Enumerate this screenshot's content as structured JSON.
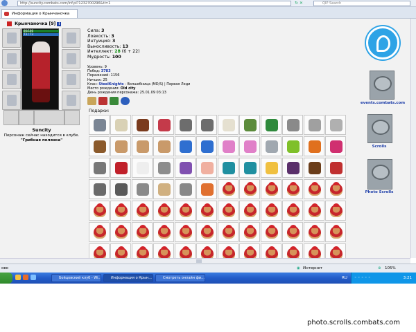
{
  "browser": {
    "url": "http://suncity.combats.com/inf.pl?1232?00296&tl=1",
    "search_placeholder": "QIP Search",
    "tab_title": "Информация о Крынчаночка"
  },
  "character": {
    "name": "Крынчаночка",
    "level_badge": "[9]",
    "info_icon_label": "i",
    "hp": "86/186",
    "mp": "73 / 73"
  },
  "stats": [
    {
      "label": "Сила:",
      "value": "3"
    },
    {
      "label": "Ловкость:",
      "value": "3"
    },
    {
      "label": "Интуиция:",
      "value": "3"
    },
    {
      "label": "Выносливость:",
      "value": "13"
    },
    {
      "label": "Интеллект:",
      "value": "28",
      "extra": "(6 + 22)"
    },
    {
      "label": "Мудрость:",
      "value": "100"
    }
  ],
  "details": {
    "level": "Уровень: 9",
    "wins_label": "Побед:",
    "wins": "3783",
    "losses": "Поражений: 1156",
    "draws": "Ничьих: 25",
    "clan_label": "Клан:",
    "clan_name": "SteelKnights",
    "clan_rest": "- Волшебница (MD/S) | Первая Леди",
    "birthplace_label": "Место рождения:",
    "birthplace": "Old city",
    "birthday": "День рождения персонажа: 25.01.09 03:13"
  },
  "location": {
    "city": "Suncity",
    "text": "Персонаж сейчас находится в клубе.",
    "room": "\"Грибная полянка\""
  },
  "gifts_label": "Подарки:",
  "gifts": [
    [
      "box",
      "flower-basket",
      "chocolate",
      "pennant",
      "wrench",
      "wrench",
      "necklace",
      "sword-plant",
      "leaf-banner",
      "key",
      "key",
      "key"
    ],
    [
      "rocking-horse",
      "teddy-bear",
      "teddy-bear",
      "teddy-bear",
      "blue-hat",
      "blue-hat",
      "pink-ring",
      "pink-ring",
      "gift-box",
      "green-fan",
      "orange-ring",
      "pink-flower"
    ],
    [
      "shield-ring",
      "red-fan",
      "bunny",
      "silver-ring",
      "potion",
      "doll",
      "fir-tree",
      "fir-tree",
      "candle",
      "treasure-chest",
      "scorpion",
      "jester-hat"
    ],
    [
      "knight",
      "helmet",
      "star-flower",
      "scroll",
      "fork",
      "fan",
      "bear",
      "bear",
      "bear",
      "bear",
      "bear",
      "bear"
    ],
    [
      "bear",
      "bear",
      "bear",
      "bear",
      "bear",
      "bear",
      "bear",
      "bear",
      "bear",
      "bear",
      "bear",
      "bear"
    ],
    [
      "bear",
      "bear",
      "bear",
      "bear",
      "bear",
      "bear",
      "bear",
      "bear",
      "bear",
      "bear",
      "bear",
      "bear"
    ],
    [
      "bear",
      "bear",
      "bear",
      "bear",
      "bear",
      "bear",
      "bear",
      "bear",
      "bear",
      "bear",
      "bear",
      "bear"
    ]
  ],
  "right_links": {
    "events": "events.combats.com",
    "scrolls": "Scrolls",
    "photo_scrolls": "Photo Scrolls"
  },
  "statusbar": {
    "left": "ово",
    "zone": "Интернет",
    "zoom": "105%"
  },
  "taskbar": {
    "tasks": [
      "Бойцовский клуб - Wi...",
      "Информация о Крын...",
      "Смотреть онлайн фи..."
    ],
    "lang": "RU",
    "clock": "3:21"
  },
  "watermark": "photo.scrolls.combats.com",
  "colors": {
    "accent_blue": "#2ea3e6",
    "taskbar": "#225cc8",
    "banner_grey": "#9aa3aa",
    "bear_red": "#c7262b"
  }
}
